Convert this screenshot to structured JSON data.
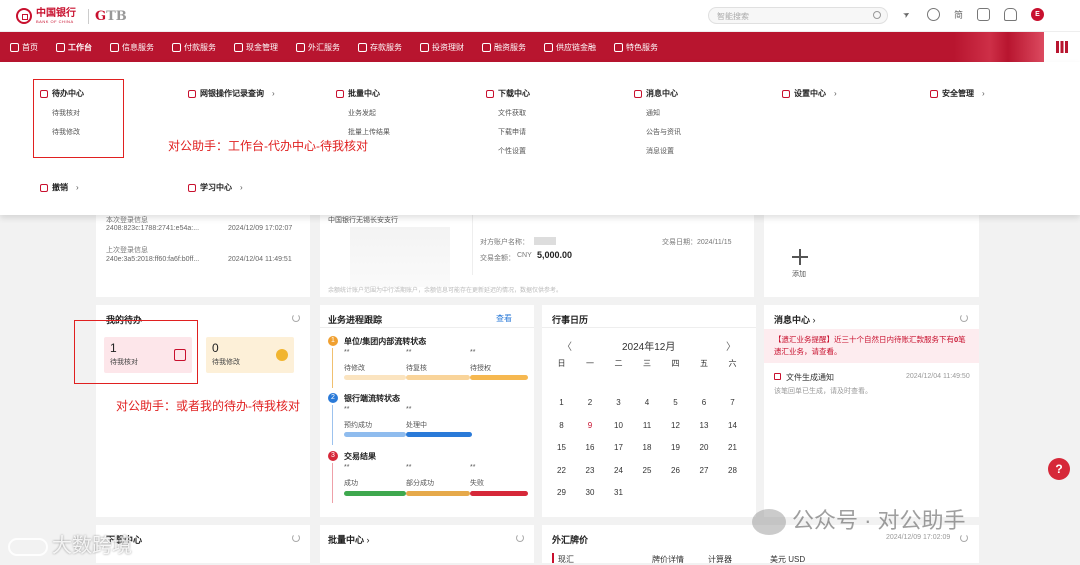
{
  "header": {
    "logo_cn": "中国银行",
    "logo_en": "BANK OF CHINA",
    "gtb_prefix": "G",
    "gtb_rest": "TB",
    "search_placeholder": "智能搜索",
    "lang": "简",
    "user_initial": "E"
  },
  "nav": {
    "items": [
      "首页",
      "工作台",
      "信息服务",
      "付款服务",
      "现金管理",
      "外汇服务",
      "存款服务",
      "投资理财",
      "融资服务",
      "供应链金融",
      "特色服务"
    ],
    "accent": "#b8152f"
  },
  "mega": {
    "todo_center": "待办中心",
    "todo_items": [
      "待我核对",
      "待我修改"
    ],
    "op_log": "网银操作记录查询",
    "batch_center": "批量中心",
    "batch_items": [
      "业务发起",
      "批量上传结果"
    ],
    "download_center": "下载中心",
    "download_items": [
      "文件获取",
      "下载申请",
      "个性设置"
    ],
    "message_center": "消息中心",
    "message_items": [
      "通知",
      "公告与资讯",
      "消息设置"
    ],
    "settings_center": "设置中心",
    "security": "安全管理",
    "revoke": "撤销",
    "learning": "学习中心"
  },
  "annotations": {
    "a1": "对公助手：工作台-代办中心-待我核对",
    "a2": "对公助手：或者我的待办-待我核对"
  },
  "login": {
    "this_label": "本次登录信息",
    "this_ip": "2408:823c:1788:2741:e54a:...",
    "this_time": "2024/12/09 17:02:07",
    "last_label": "上次登录信息",
    "last_ip": "240e:3a5:2018:ff60:fa6f:b0ff...",
    "last_time": "2024/12/04 11:49:51"
  },
  "account": {
    "bank": "中国银行无锡长安支行",
    "payee_label": "对方账户名称：",
    "date_label": "交易日期：2024/11/15",
    "amount_label": "交易金额：",
    "currency": "CNY",
    "amount": "5,000.00",
    "note": "余额统计账户范围为中行活期账户，余额信息可能存在更新延迟的情况，数据仅供参考。"
  },
  "add": {
    "label": "添加"
  },
  "my_todo": {
    "title": "我的待办",
    "check_count": "1",
    "check_label": "待我核对",
    "modify_count": "0",
    "modify_label": "待我修改"
  },
  "progress": {
    "title": "业务进程跟踪",
    "view": "查看",
    "sections": [
      {
        "num": "1",
        "title": "单位/集团内部流转状态",
        "cols": [
          "待修改",
          "待复核",
          "待授权"
        ],
        "values": [
          "**",
          "**",
          "**"
        ]
      },
      {
        "num": "2",
        "title": "银行端流转状态",
        "cols": [
          "预约成功",
          "处理中"
        ],
        "values": [
          "**",
          "**"
        ]
      },
      {
        "num": "3",
        "title": "交易结果",
        "cols": [
          "成功",
          "部分成功",
          "失败"
        ],
        "values": [
          "**",
          "**",
          "**"
        ]
      }
    ]
  },
  "calendar": {
    "title": "行事日历",
    "month": "2024年12月",
    "prev": "〈",
    "next": "〉",
    "weekdays": [
      "日",
      "一",
      "二",
      "三",
      "四",
      "五",
      "六"
    ],
    "weeks": [
      [
        "1",
        "2",
        "3",
        "4",
        "5",
        "6",
        "7"
      ],
      [
        "8",
        "9",
        "10",
        "11",
        "12",
        "13",
        "14"
      ],
      [
        "15",
        "16",
        "17",
        "18",
        "19",
        "20",
        "21"
      ],
      [
        "22",
        "23",
        "24",
        "25",
        "26",
        "27",
        "28"
      ],
      [
        "29",
        "30",
        "31",
        "",
        "",
        "",
        ""
      ]
    ],
    "highlight": "9"
  },
  "messages": {
    "title": "消息中心",
    "alert_pre": "【遗汇业务提醒】近三十个自然日内待账汇款服务下有",
    "alert_num": "0",
    "alert_post": "笔遗汇业务，请查看。",
    "notice_title": "文件生成通知",
    "notice_time": "2024/12/04 11:49:50",
    "notice_body": "该笔回单已生成，请及时查看。"
  },
  "bottom": {
    "download": "下载中心",
    "batch": "批量中心",
    "fx": "外汇牌价",
    "fx_tab": "现汇",
    "fx_detail": "牌价详情",
    "calculator": "计算器",
    "currency": "美元 USD",
    "fx_time": "2024/12/09 17:02:09"
  },
  "watermarks": {
    "wechat": "公众号 · 对公助手",
    "bigdata": "大数跨境"
  },
  "help": "?"
}
